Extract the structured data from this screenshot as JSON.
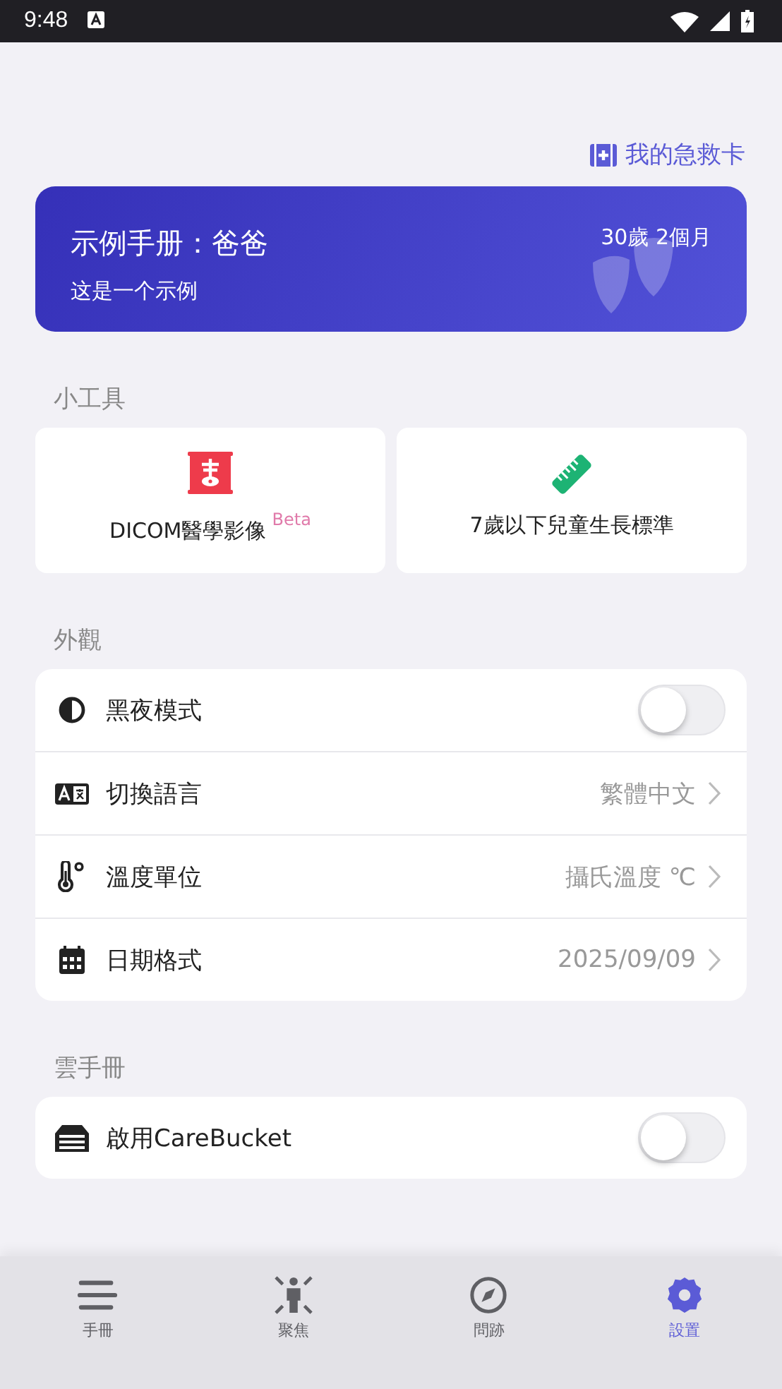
{
  "status_bar": {
    "time": "9:48"
  },
  "emergency_link": "我的急救卡",
  "profile_card": {
    "title": "示例手册：爸爸",
    "subtitle": "这是一个示例",
    "age": "30歲 2個月"
  },
  "tools": {
    "heading": "小工具",
    "items": [
      {
        "label": "DICOM醫學影像",
        "badge": "Beta"
      },
      {
        "label": "7歲以下兒童生長標準"
      }
    ]
  },
  "appearance": {
    "heading": "外觀",
    "items": [
      {
        "kind": "toggle",
        "label": "黑夜模式",
        "on": false
      },
      {
        "kind": "nav",
        "label": "切換語言",
        "value": "繁體中文"
      },
      {
        "kind": "nav",
        "label": "溫度單位",
        "value": "攝氏溫度 ℃"
      },
      {
        "kind": "nav",
        "label": "日期格式",
        "value": "2025/09/09"
      }
    ]
  },
  "cloud": {
    "heading": "雲手冊",
    "items": [
      {
        "kind": "toggle",
        "label": "啟用CareBucket",
        "on": false
      }
    ]
  },
  "tab_bar": [
    {
      "label": "手冊",
      "selected": false
    },
    {
      "label": "聚焦",
      "selected": false
    },
    {
      "label": "問跡",
      "selected": false
    },
    {
      "label": "設置",
      "selected": true
    }
  ]
}
